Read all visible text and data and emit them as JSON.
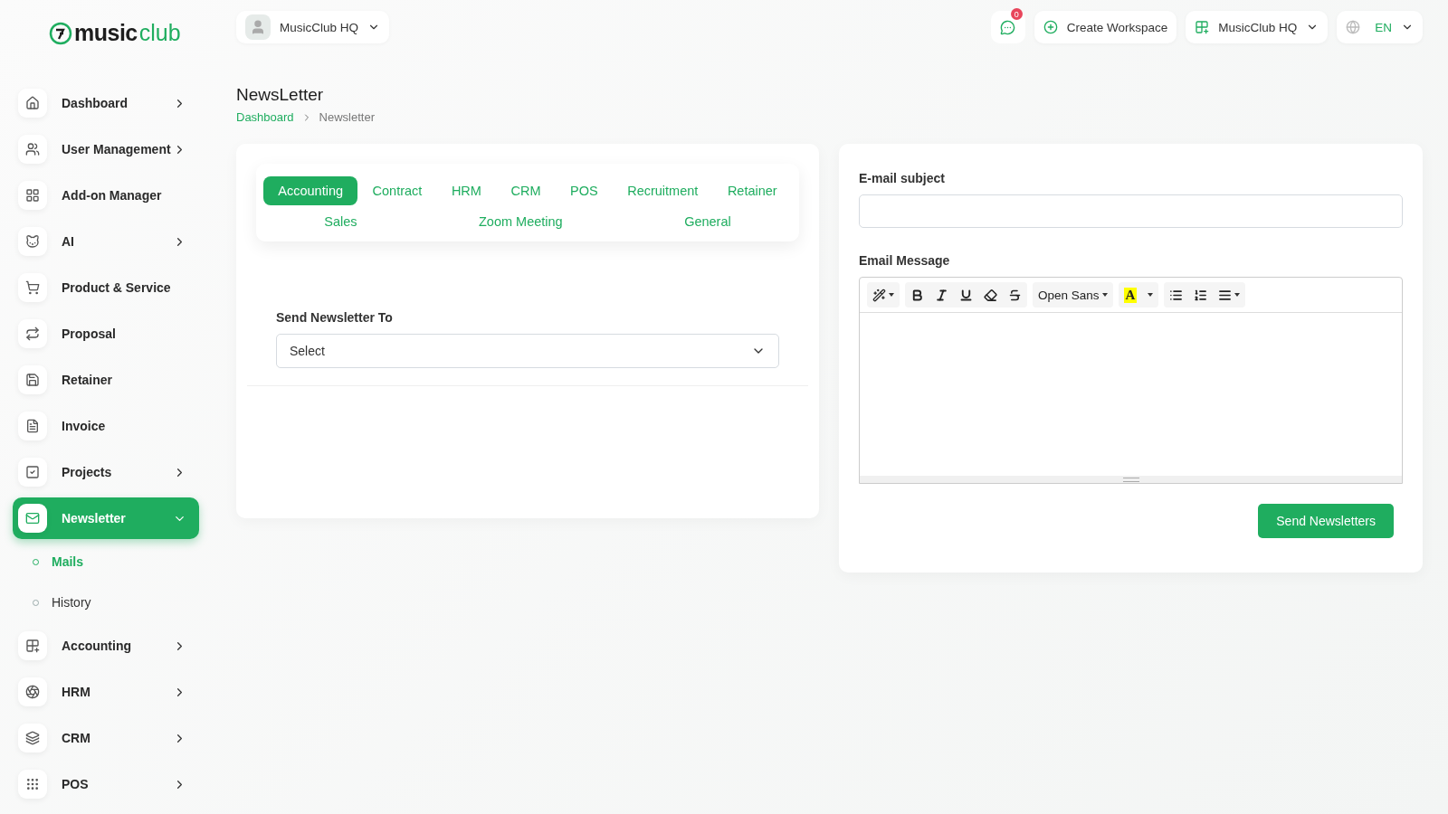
{
  "logo": {
    "bold": "music",
    "light": "club"
  },
  "workspace_switch": {
    "label": "MusicClub HQ"
  },
  "header": {
    "notification_count": "0",
    "create_label": "Create Workspace",
    "workspace_label": "MusicClub HQ",
    "language": "EN"
  },
  "sidebar": {
    "items": [
      {
        "label": "Dashboard",
        "expandable": true,
        "expanded": false,
        "selected": false
      },
      {
        "label": "User Management",
        "expandable": true,
        "expanded": false,
        "selected": false
      },
      {
        "label": "Add-on Manager",
        "expandable": false,
        "selected": false
      },
      {
        "label": "AI",
        "expandable": true,
        "expanded": false,
        "selected": false
      },
      {
        "label": "Product & Service",
        "expandable": false,
        "selected": false
      },
      {
        "label": "Proposal",
        "expandable": false,
        "selected": false
      },
      {
        "label": "Retainer",
        "expandable": false,
        "selected": false
      },
      {
        "label": "Invoice",
        "expandable": false,
        "selected": false
      },
      {
        "label": "Projects",
        "expandable": true,
        "expanded": false,
        "selected": false
      },
      {
        "label": "Newsletter",
        "expandable": true,
        "expanded": true,
        "selected": true,
        "children": [
          {
            "label": "Mails",
            "selected": true
          },
          {
            "label": "History",
            "selected": false
          }
        ]
      },
      {
        "label": "Accounting",
        "expandable": true,
        "expanded": false,
        "selected": false
      },
      {
        "label": "HRM",
        "expandable": true,
        "expanded": false,
        "selected": false
      },
      {
        "label": "CRM",
        "expandable": true,
        "expanded": false,
        "selected": false
      },
      {
        "label": "POS",
        "expandable": true,
        "expanded": false,
        "selected": false
      }
    ]
  },
  "page": {
    "title": "NewsLetter",
    "breadcrumb": [
      {
        "label": "Dashboard",
        "link": true
      },
      {
        "label": "Newsletter",
        "link": false
      }
    ]
  },
  "tabs": [
    {
      "label": "Accounting",
      "selected": true
    },
    {
      "label": "Contract",
      "selected": false
    },
    {
      "label": "HRM",
      "selected": false
    },
    {
      "label": "CRM",
      "selected": false
    },
    {
      "label": "POS",
      "selected": false
    },
    {
      "label": "Recruitment",
      "selected": false
    },
    {
      "label": "Retainer",
      "selected": false
    },
    {
      "label": "Sales",
      "selected": false
    },
    {
      "label": "Zoom Meeting",
      "selected": false
    },
    {
      "label": "General",
      "selected": false
    }
  ],
  "send_to": {
    "label": "Send Newsletter To",
    "value": "Select"
  },
  "email_subject": {
    "label": "E-mail subject"
  },
  "email_message": {
    "label": "Email Message",
    "font": "Open Sans",
    "color_letter": "A"
  },
  "send_button": "Send Newsletters"
}
